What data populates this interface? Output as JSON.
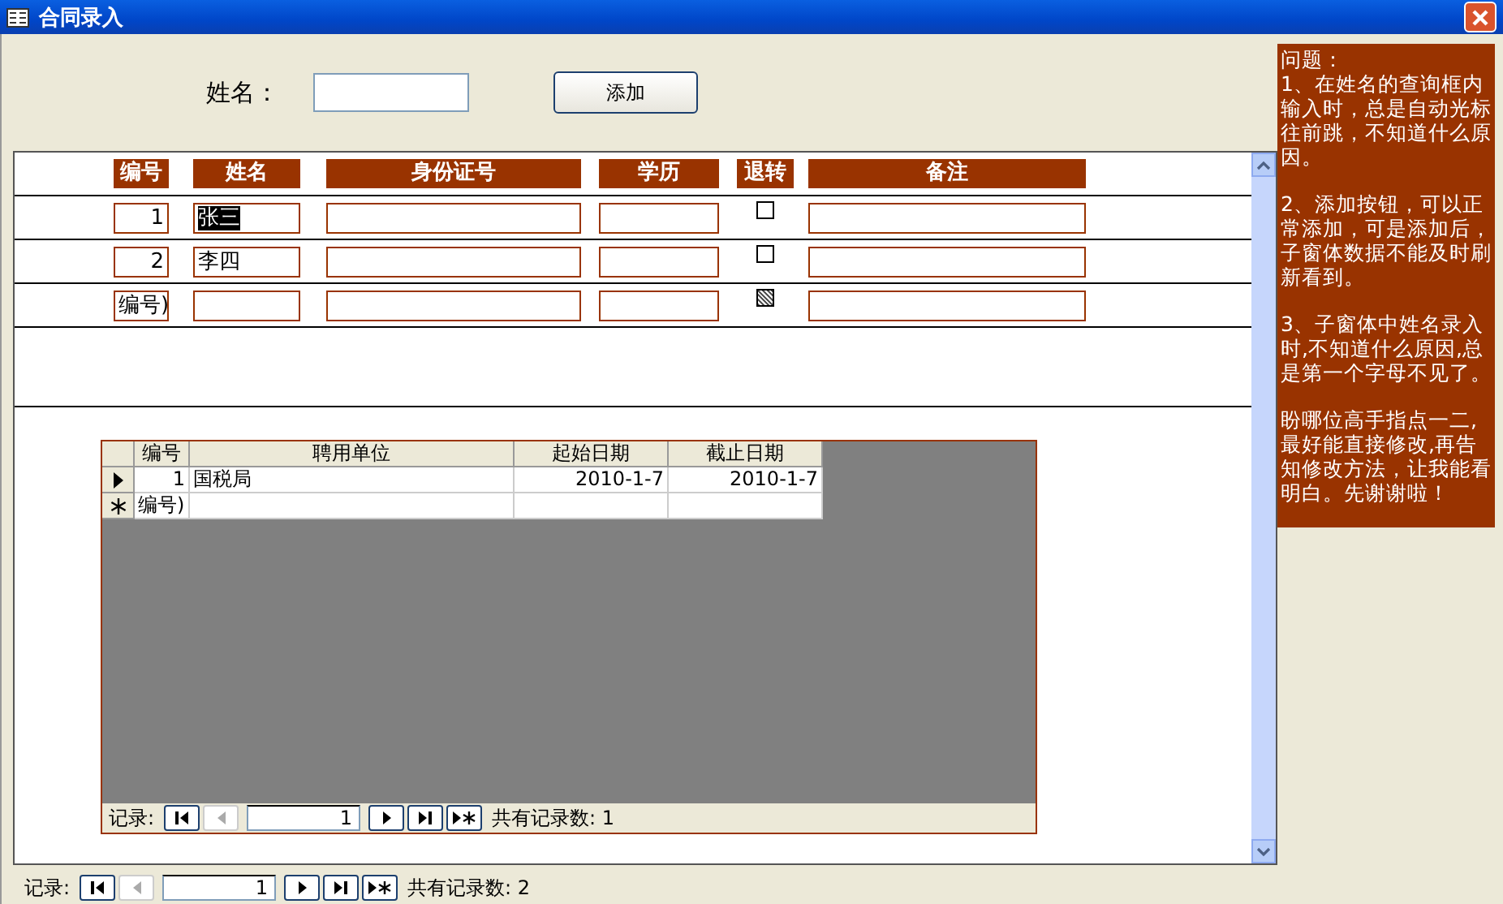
{
  "window": {
    "title": "合同录入"
  },
  "search": {
    "label": "姓名："
  },
  "add_button": {
    "label": "添加"
  },
  "form": {
    "columns": [
      "编号",
      "姓名",
      "身份证号",
      "学历",
      "退转",
      "备注"
    ],
    "rows": [
      {
        "kind": "record",
        "id": "1",
        "name": "张三",
        "name_highlighted": true,
        "checked": false
      },
      {
        "kind": "record",
        "id": "2",
        "name": "李四",
        "name_highlighted": false,
        "checked": false
      },
      {
        "kind": "new",
        "id": "编号)"
      }
    ],
    "subform": {
      "columns": [
        "编号",
        "聘用单位",
        "起始日期",
        "截止日期"
      ],
      "rows": [
        {
          "kind": "current",
          "cells": [
            "1",
            "国税局",
            "2010-1-7",
            "2010-1-7"
          ]
        },
        {
          "kind": "new",
          "cells": [
            "编号)",
            "",
            "",
            ""
          ]
        }
      ],
      "nav": {
        "label": "记录:",
        "current": "1",
        "count": "共有记录数: 1",
        "buttons": [
          {
            "kind": "first",
            "disabled": false
          },
          {
            "kind": "prev",
            "disabled": true
          },
          {
            "kind": "next",
            "disabled": false
          },
          {
            "kind": "last",
            "disabled": false
          },
          {
            "kind": "new",
            "disabled": false
          }
        ]
      }
    }
  },
  "nav": {
    "label": "记录:",
    "current": "1",
    "count": "共有记录数: 2",
    "buttons": [
      {
        "kind": "first",
        "disabled": false
      },
      {
        "kind": "prev",
        "disabled": true
      },
      {
        "kind": "next",
        "disabled": false
      },
      {
        "kind": "last",
        "disabled": false
      },
      {
        "kind": "new",
        "disabled": false
      }
    ]
  },
  "notes": [
    "问题：",
    "1、在姓名的查询框内输入时，总是自动光标往前跳，不知道什么原因。",
    "2、添加按钮，可以正常添加，可是添加后，子窗体数据不能及时刷新看到。",
    "3、子窗体中姓名录入时,不知道什么原因,总是第一个字母不见了。",
    "盼哪位高手指点一二,最好能直接修改,再告知修改方法，让我能看明白。先谢谢啦！"
  ]
}
